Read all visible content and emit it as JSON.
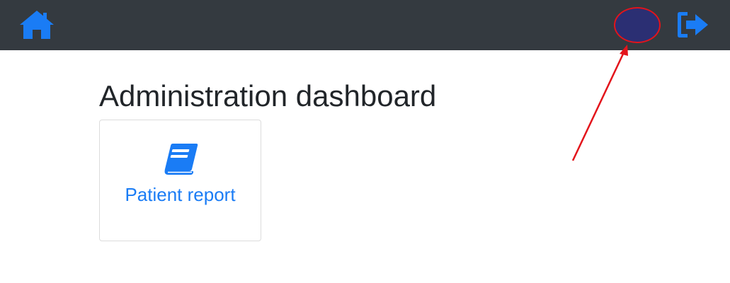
{
  "header": {
    "home_icon": "home-icon",
    "avatar_color": "#2b2f73",
    "logout_icon": "sign-out-icon",
    "background_color": "#343a40",
    "icon_color": "#1a7cf5"
  },
  "main": {
    "title": "Administration dashboard",
    "cards": [
      {
        "label": "Patient report",
        "icon": "book-icon"
      }
    ]
  },
  "annotation": {
    "type": "red-arrow-pointing-to-avatar",
    "color": "#e3141b"
  }
}
